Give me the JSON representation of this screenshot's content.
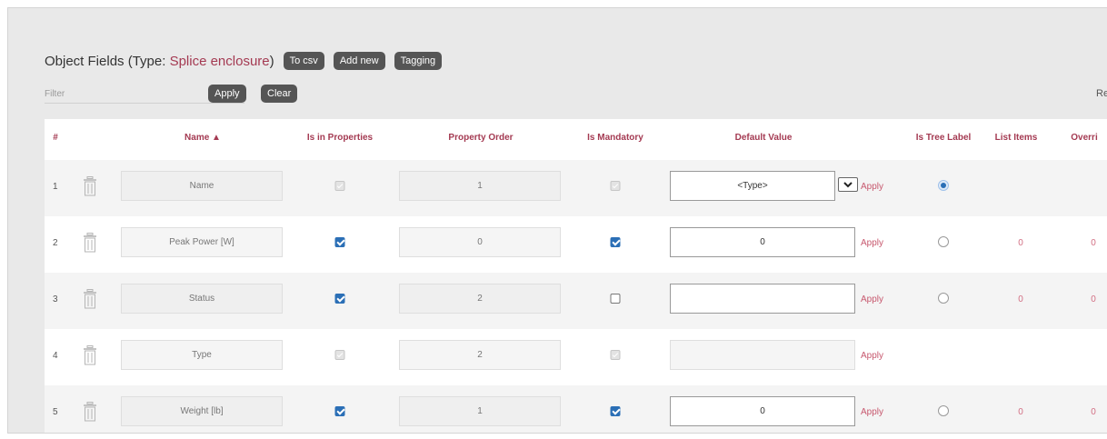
{
  "header": {
    "title_prefix": "Object Fields (Type: ",
    "type_name": "Splice enclosure",
    "title_suffix": ")",
    "buttons": {
      "to_csv": "To csv",
      "add_new": "Add new",
      "tagging": "Tagging"
    }
  },
  "filter": {
    "placeholder": "Filter",
    "apply_label": "Apply",
    "clear_label": "Clear",
    "right_text": "Re"
  },
  "columns": {
    "number": "#",
    "name": "Name ▲",
    "is_in_properties": "Is in Properties",
    "property_order": "Property Order",
    "is_mandatory": "Is Mandatory",
    "default_value": "Default Value",
    "is_tree_label": "Is Tree Label",
    "list_items": "List Items",
    "overrides": "Overri"
  },
  "rows": [
    {
      "num": "1",
      "name": "Name",
      "order": "1",
      "default": "<Type>",
      "apply": "Apply"
    },
    {
      "num": "2",
      "name": "Peak Power [W]",
      "order": "0",
      "default": "0",
      "apply": "Apply",
      "list_items": "0",
      "overrides": "0"
    },
    {
      "num": "3",
      "name": "Status",
      "order": "2",
      "default": "",
      "apply": "Apply",
      "list_items": "0",
      "overrides": "0"
    },
    {
      "num": "4",
      "name": "Type",
      "order": "2",
      "default": "",
      "apply": "Apply"
    },
    {
      "num": "5",
      "name": "Weight [lb]",
      "order": "1",
      "default": "0",
      "apply": "Apply",
      "list_items": "0",
      "overrides": "0"
    }
  ],
  "colors": {
    "accent": "#a43a52",
    "pill_bg": "#555555",
    "checkbox_blue": "#2b6fb6",
    "link": "#c7586e"
  },
  "icons": {
    "delete": "trash-icon",
    "dropdown": "chevron-down-icon"
  }
}
